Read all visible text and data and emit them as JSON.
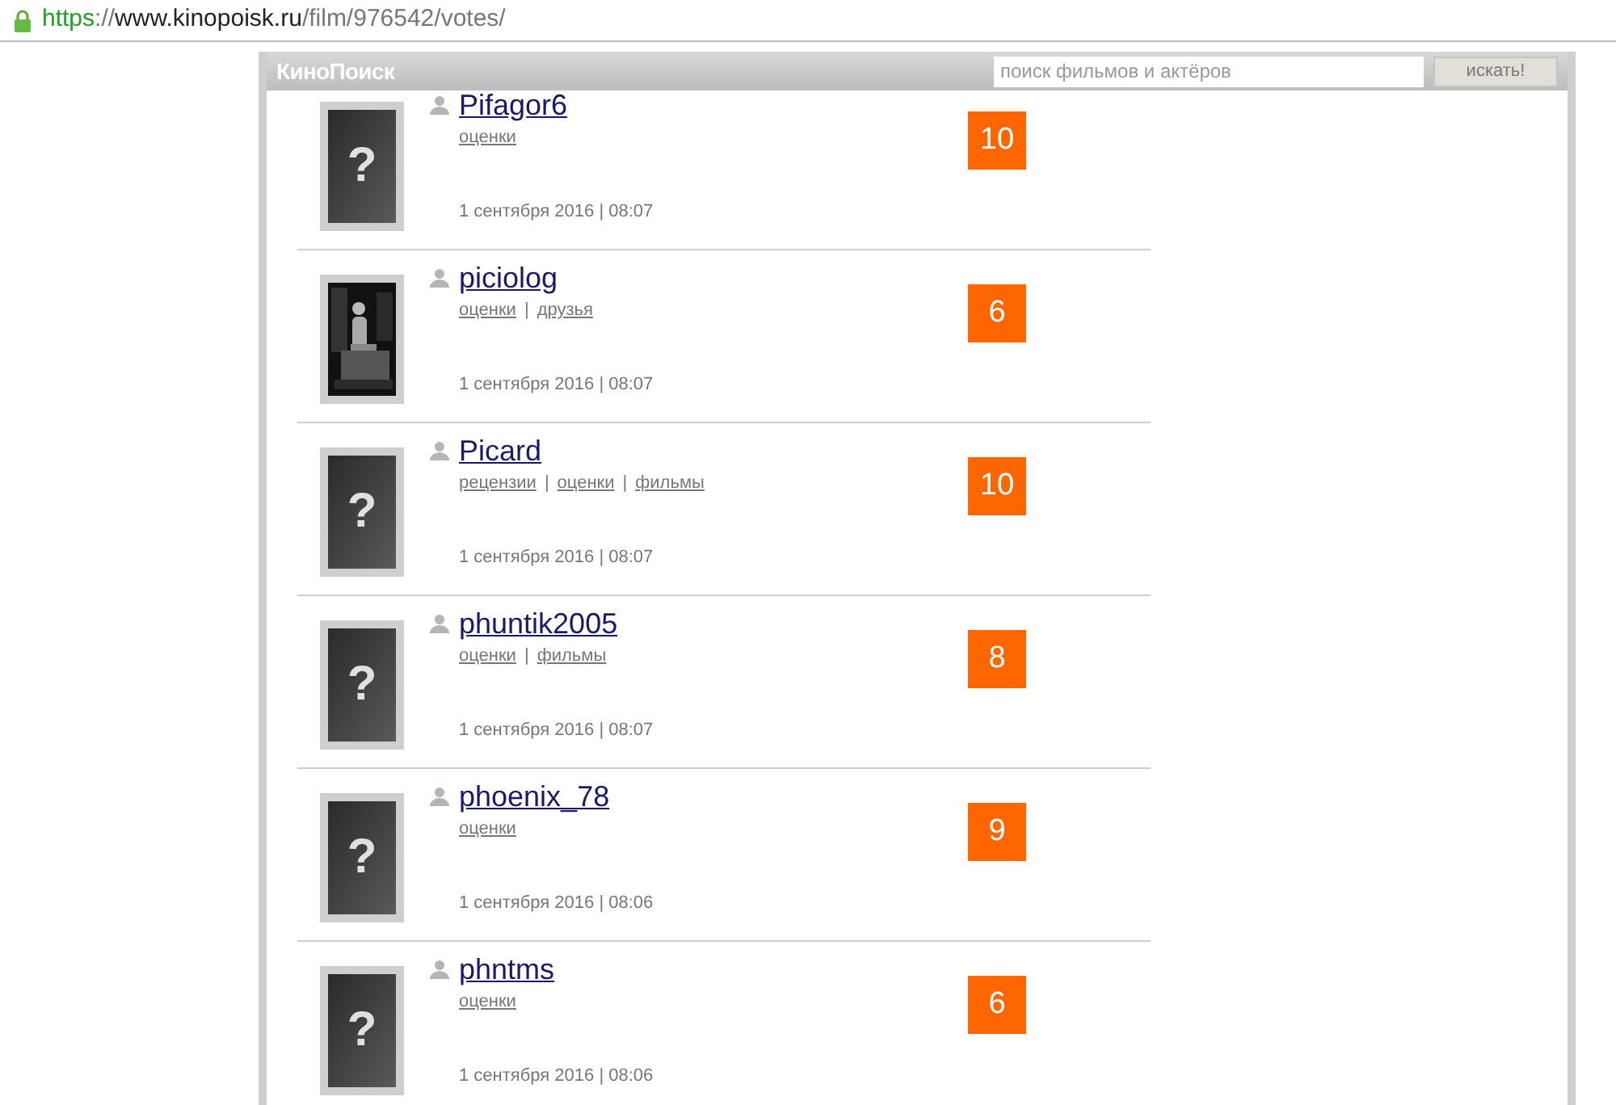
{
  "address_bar": {
    "scheme": "https",
    "separator": "://",
    "host": "www.kinopoisk.ru",
    "path": "/film/976542/votes/"
  },
  "header": {
    "logo": "КиноПоиск",
    "search": {
      "placeholder": "поиск фильмов и актёров"
    },
    "search_button": "искать!"
  },
  "votes": [
    {
      "user": "Pifagor6",
      "avatar": {
        "kind": "placeholder",
        "mark": "?"
      },
      "links": [
        "оценки"
      ],
      "date": "1 сентября 2016 | 08:07",
      "score": "10"
    },
    {
      "user": "piciolog",
      "avatar": {
        "kind": "picture"
      },
      "links": [
        "оценки",
        "друзья"
      ],
      "date": "1 сентября 2016 | 08:07",
      "score": "6"
    },
    {
      "user": "Picard",
      "avatar": {
        "kind": "placeholder",
        "mark": "?"
      },
      "links": [
        "рецензии",
        "оценки",
        "фильмы"
      ],
      "date": "1 сентября 2016 | 08:07",
      "score": "10"
    },
    {
      "user": "phuntik2005",
      "avatar": {
        "kind": "placeholder",
        "mark": "?"
      },
      "links": [
        "оценки",
        "фильмы"
      ],
      "date": "1 сентября 2016 | 08:07",
      "score": "8"
    },
    {
      "user": "phoenix_78",
      "avatar": {
        "kind": "placeholder",
        "mark": "?"
      },
      "links": [
        "оценки"
      ],
      "date": "1 сентября 2016 | 08:06",
      "score": "9"
    },
    {
      "user": "phntms",
      "avatar": {
        "kind": "placeholder",
        "mark": "?"
      },
      "links": [
        "оценки"
      ],
      "date": "1 сентября 2016 | 08:06",
      "score": "6"
    }
  ],
  "link_separator": "|"
}
